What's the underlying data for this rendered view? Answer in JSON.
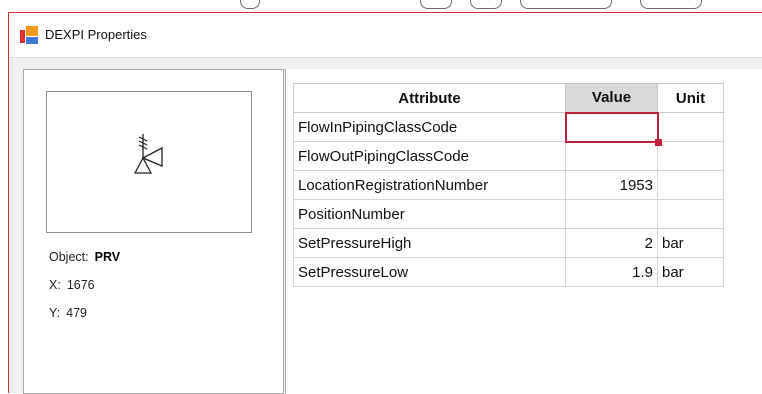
{
  "window": {
    "title": "DEXPI Properties",
    "icon": "dexpi-app-icon"
  },
  "object_panel": {
    "preview_icon": "pressure-relief-valve-symbol",
    "object_label": "Object:",
    "object_value": "PRV",
    "x_label": "X:",
    "x_value": "1676",
    "y_label": "Y:",
    "y_value": "479"
  },
  "grid": {
    "headers": {
      "attribute": "Attribute",
      "value": "Value",
      "unit": "Unit"
    },
    "sorted_column": "value",
    "rows": [
      {
        "attribute": "FlowInPipingClassCode",
        "value": "",
        "unit": ""
      },
      {
        "attribute": "FlowOutPipingClassCode",
        "value": "",
        "unit": ""
      },
      {
        "attribute": "LocationRegistrationNumber",
        "value": "1953",
        "unit": ""
      },
      {
        "attribute": "PositionNumber",
        "value": "",
        "unit": ""
      },
      {
        "attribute": "SetPressureHigh",
        "value": "2",
        "unit": "bar"
      },
      {
        "attribute": "SetPressureLow",
        "value": "1.9",
        "unit": "bar"
      }
    ],
    "active_cell": {
      "row": 0,
      "column": "value"
    }
  },
  "colors": {
    "accent_red": "#c0203a",
    "header_sorted_bg": "#d9d9d9",
    "dialog_bg": "#f0f0f0"
  }
}
